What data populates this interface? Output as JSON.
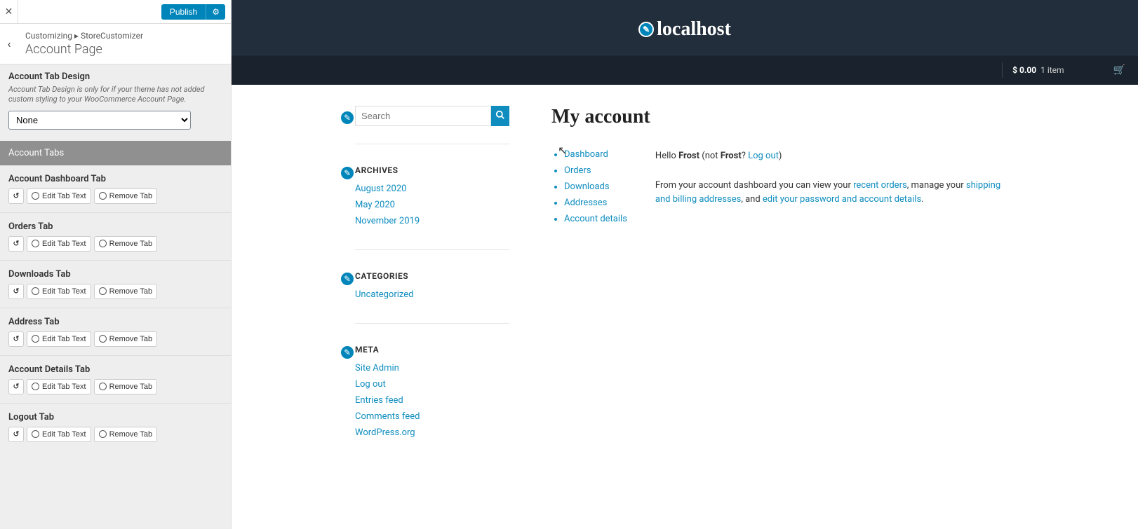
{
  "sidebar": {
    "publish": "Publish",
    "breadcrumb_prefix": "Customizing",
    "breadcrumb_section": "StoreCustomizer",
    "page_title": "Account Page",
    "design_heading": "Account Tab Design",
    "design_desc": "Account Tab Design is only for if your theme has not added custom styling to your WooCommerce Account Page.",
    "design_select": "None",
    "tabs_header": "Account Tabs",
    "edit_label": "Edit Tab Text",
    "remove_label": "Remove Tab",
    "tabs": [
      {
        "label": "Account Dashboard Tab"
      },
      {
        "label": "Orders Tab"
      },
      {
        "label": "Downloads Tab"
      },
      {
        "label": "Address Tab"
      },
      {
        "label": "Account Details Tab"
      },
      {
        "label": "Logout Tab"
      }
    ]
  },
  "site": {
    "title": "localhost",
    "cart_price": "$ 0.00",
    "cart_items": "1 item"
  },
  "widgets": {
    "search_placeholder": "Search",
    "archives_title": "ARCHIVES",
    "archives": [
      "August 2020",
      "May 2020",
      "November 2019"
    ],
    "categories_title": "CATEGORIES",
    "categories": [
      "Uncategorized"
    ],
    "meta_title": "META",
    "meta": [
      "Site Admin",
      "Log out",
      "Entries feed",
      "Comments feed",
      "WordPress.org"
    ]
  },
  "account": {
    "heading": "My account",
    "nav": [
      "Dashboard",
      "Orders",
      "Downloads",
      "Addresses",
      "Account details"
    ],
    "hello_pre": "Hello ",
    "user": "Frost",
    "hello_mid": " (not ",
    "user2": "Frost",
    "hello_q": "? ",
    "logout": "Log out",
    "hello_end": ")",
    "dash_pre": "From your account dashboard you can view your ",
    "recent_orders": "recent orders",
    "dash_mid1": ", manage your ",
    "shipping": "shipping and billing addresses",
    "dash_mid2": ", and ",
    "edit_pw": "edit your password and account details",
    "dash_end": "."
  }
}
